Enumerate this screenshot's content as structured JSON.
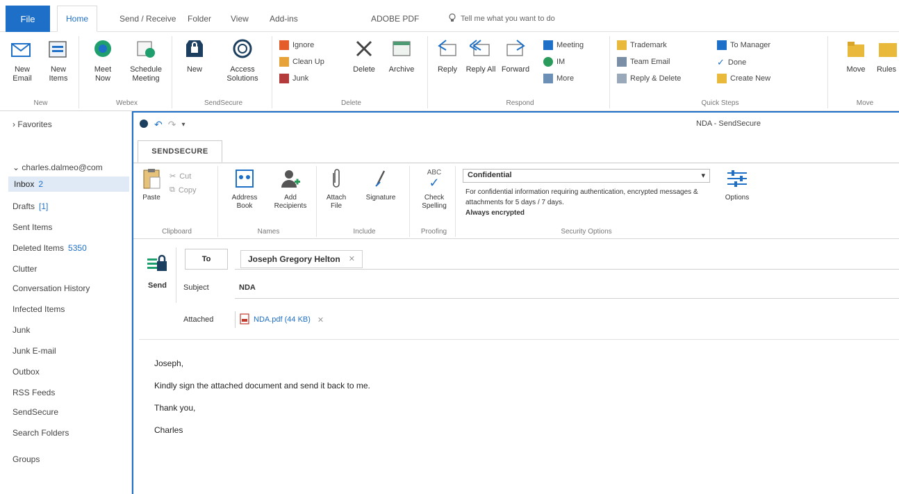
{
  "ribbon_tabs": {
    "file": "File",
    "items": [
      "Home",
      "Send / Receive",
      "Folder",
      "View",
      "Add-ins",
      "ADOBE PDF"
    ],
    "tell_me": "Tell me what you want to do"
  },
  "ribbon_groups": {
    "new": {
      "label": "New",
      "new_email": "New Email",
      "new_items": "New Items"
    },
    "webex": {
      "label": "Webex",
      "meet_now": "Meet Now",
      "schedule_meeting": "Schedule Meeting"
    },
    "sendsecure": {
      "label": "SendSecure",
      "new": "New",
      "access_solutions": "Access Solutions"
    },
    "delete": {
      "label": "Delete",
      "ignore": "Ignore",
      "clean_up": "Clean Up",
      "junk": "Junk",
      "delete": "Delete",
      "archive": "Archive"
    },
    "respond": {
      "label": "Respond",
      "reply": "Reply",
      "reply_all": "Reply All",
      "forward": "Forward",
      "meeting": "Meeting",
      "im": "IM",
      "more": "More"
    },
    "quick_steps": {
      "label": "Quick Steps",
      "items": [
        "Trademark",
        "Team Email",
        "Reply & Delete",
        "To Manager",
        "Done",
        "Create New"
      ]
    },
    "move": {
      "label": "Move",
      "move": "Move",
      "rules": "Rules"
    }
  },
  "left_nav": {
    "favorites": "Favorites",
    "account": "charles.dalmeo@com",
    "items": [
      {
        "label": "Inbox",
        "count": "2",
        "selected": true
      },
      {
        "label": "Drafts",
        "count": "[1]"
      },
      {
        "label": "Sent Items",
        "count": ""
      },
      {
        "label": "Deleted Items",
        "count": "5350"
      },
      {
        "label": "Clutter",
        "count": ""
      },
      {
        "label": "Conversation History",
        "count": ""
      },
      {
        "label": "Infected Items",
        "count": ""
      },
      {
        "label": "Junk",
        "count": ""
      },
      {
        "label": "Junk E-mail",
        "count": ""
      },
      {
        "label": "Outbox",
        "count": ""
      },
      {
        "label": "RSS Feeds",
        "count": ""
      },
      {
        "label": "SendSecure",
        "count": ""
      },
      {
        "label": "Search Folders",
        "count": ""
      }
    ],
    "groups": "Groups"
  },
  "compose": {
    "window_title": "NDA - SendSecure",
    "tab": "SENDSECURE",
    "clipboard": {
      "label": "Clipboard",
      "paste": "Paste",
      "cut": "Cut",
      "copy": "Copy"
    },
    "names": {
      "label": "Names",
      "address_book": "Address Book",
      "add_recipients": "Add Recipients"
    },
    "include": {
      "label": "Include",
      "attach_file": "Attach File",
      "signature": "Signature"
    },
    "proofing": {
      "label": "Proofing",
      "check_spelling": "Check Spelling",
      "abc": "ABC"
    },
    "security_options": {
      "label": "Security Options",
      "selected": "Confidential",
      "description": "For confidential information requiring authentication, encrypted messages & attachments for 5 days / 7 days.",
      "emphasis": "Always encrypted",
      "options": "Options"
    },
    "send": "Send",
    "to_label": "To",
    "recipient": "Joseph Gregory Helton",
    "subject_label": "Subject",
    "subject": "NDA",
    "attached_label": "Attached",
    "attachment": "NDA.pdf (44 KB)",
    "body": {
      "greeting": "Joseph,",
      "line1": "Kindly sign the attached document and send it back to me.",
      "closing": "Thank you,",
      "signature": "Charles"
    }
  },
  "colors": {
    "accent": "#1d6fc8",
    "selected_bg": "#dfeaf6"
  }
}
